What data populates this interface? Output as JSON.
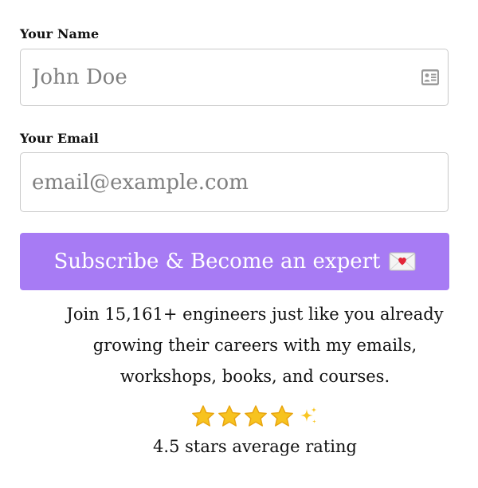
{
  "form": {
    "name_label": "Your Name",
    "name_placeholder": "John Doe",
    "name_value": "",
    "email_label": "Your Email",
    "email_placeholder": "email@example.com",
    "email_value": "",
    "contact_icon": "contact-card-icon",
    "submit_label": "Subscribe & Become an expert",
    "submit_icon": "love-letter-envelope-icon",
    "accent_color": "#a77bf4"
  },
  "blurb": {
    "lines": [
      "Join 15,161+ engineers just like you already",
      "growing their careers with my emails,",
      "workshops, books, and courses."
    ]
  },
  "rating": {
    "stars_shown": 4,
    "extra_icon": "sparkles-icon",
    "text": "4.5 stars average rating",
    "star_color": "#f7c31f"
  }
}
